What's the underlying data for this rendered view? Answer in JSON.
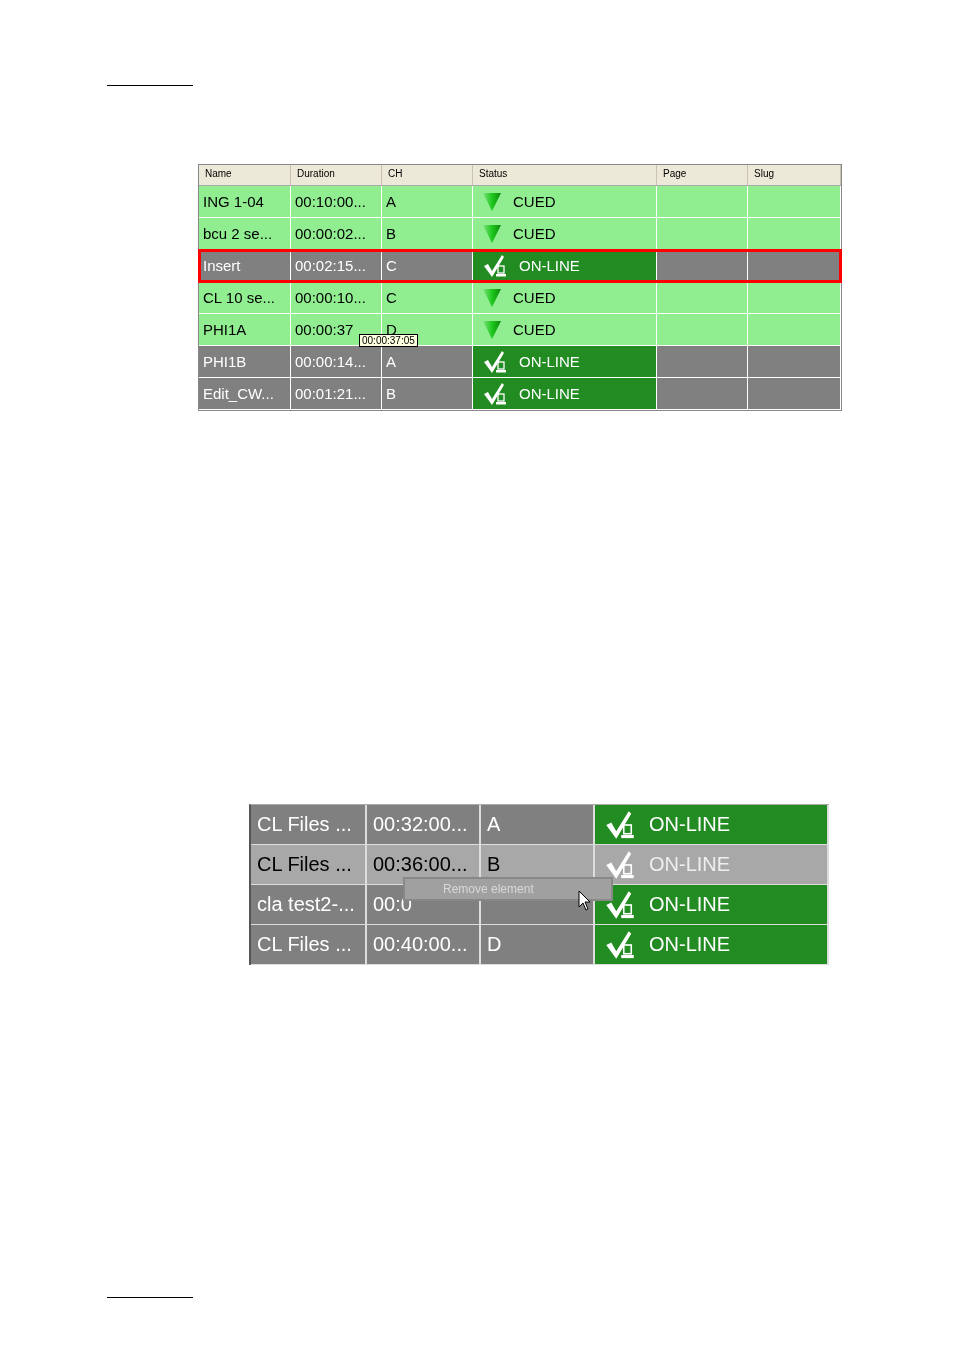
{
  "table_1": {
    "columns": [
      "Name",
      "Duration",
      "CH",
      "Status",
      "Page",
      "Slug"
    ],
    "rows": [
      {
        "name": "ING 1-04",
        "duration": "00:10:00...",
        "ch": "A",
        "status": "CUED",
        "kind": "cued",
        "selected": false
      },
      {
        "name": "bcu 2 se...",
        "duration": "00:00:02...",
        "ch": "B",
        "status": "CUED",
        "kind": "cued",
        "selected": false
      },
      {
        "name": "Insert",
        "duration": "00:02:15...",
        "ch": "C",
        "status": "ON-LINE",
        "kind": "online",
        "selected": true
      },
      {
        "name": "CL 10 se...",
        "duration": "00:00:10...",
        "ch": "C",
        "status": "CUED",
        "kind": "cued",
        "selected": false
      },
      {
        "name": "PHI1A",
        "duration": "00:00:37",
        "ch": "D",
        "status": "CUED",
        "kind": "cued",
        "selected": false
      },
      {
        "name": "PHI1B",
        "duration": "00:00:14...",
        "ch": "A",
        "status": "ON-LINE",
        "kind": "online",
        "selected": false
      },
      {
        "name": "Edit_CW...",
        "duration": "00:01:21...",
        "ch": "B",
        "status": "ON-LINE",
        "kind": "online",
        "selected": false
      }
    ],
    "tooltip": "00:00:37:05"
  },
  "table_2": {
    "rows": [
      {
        "name": "CL Files ...",
        "duration": "00:32:00...",
        "ch": "A",
        "status": "ON-LINE",
        "kind": "online",
        "selected": false
      },
      {
        "name": "CL Files ...",
        "duration": "00:36:00...",
        "ch": "B",
        "status": "ON-LINE",
        "kind": "online",
        "selected": true
      },
      {
        "name": "cla test2-...",
        "duration": "00:0",
        "status": "ON-LINE",
        "kind": "online",
        "selected": false
      },
      {
        "name": "CL Files ...",
        "duration": "00:40:00...",
        "ch": "D",
        "status": "ON-LINE",
        "kind": "online",
        "selected": false
      }
    ],
    "context_menu": {
      "items": [
        {
          "label": "Remove element",
          "disabled": true
        }
      ]
    }
  }
}
